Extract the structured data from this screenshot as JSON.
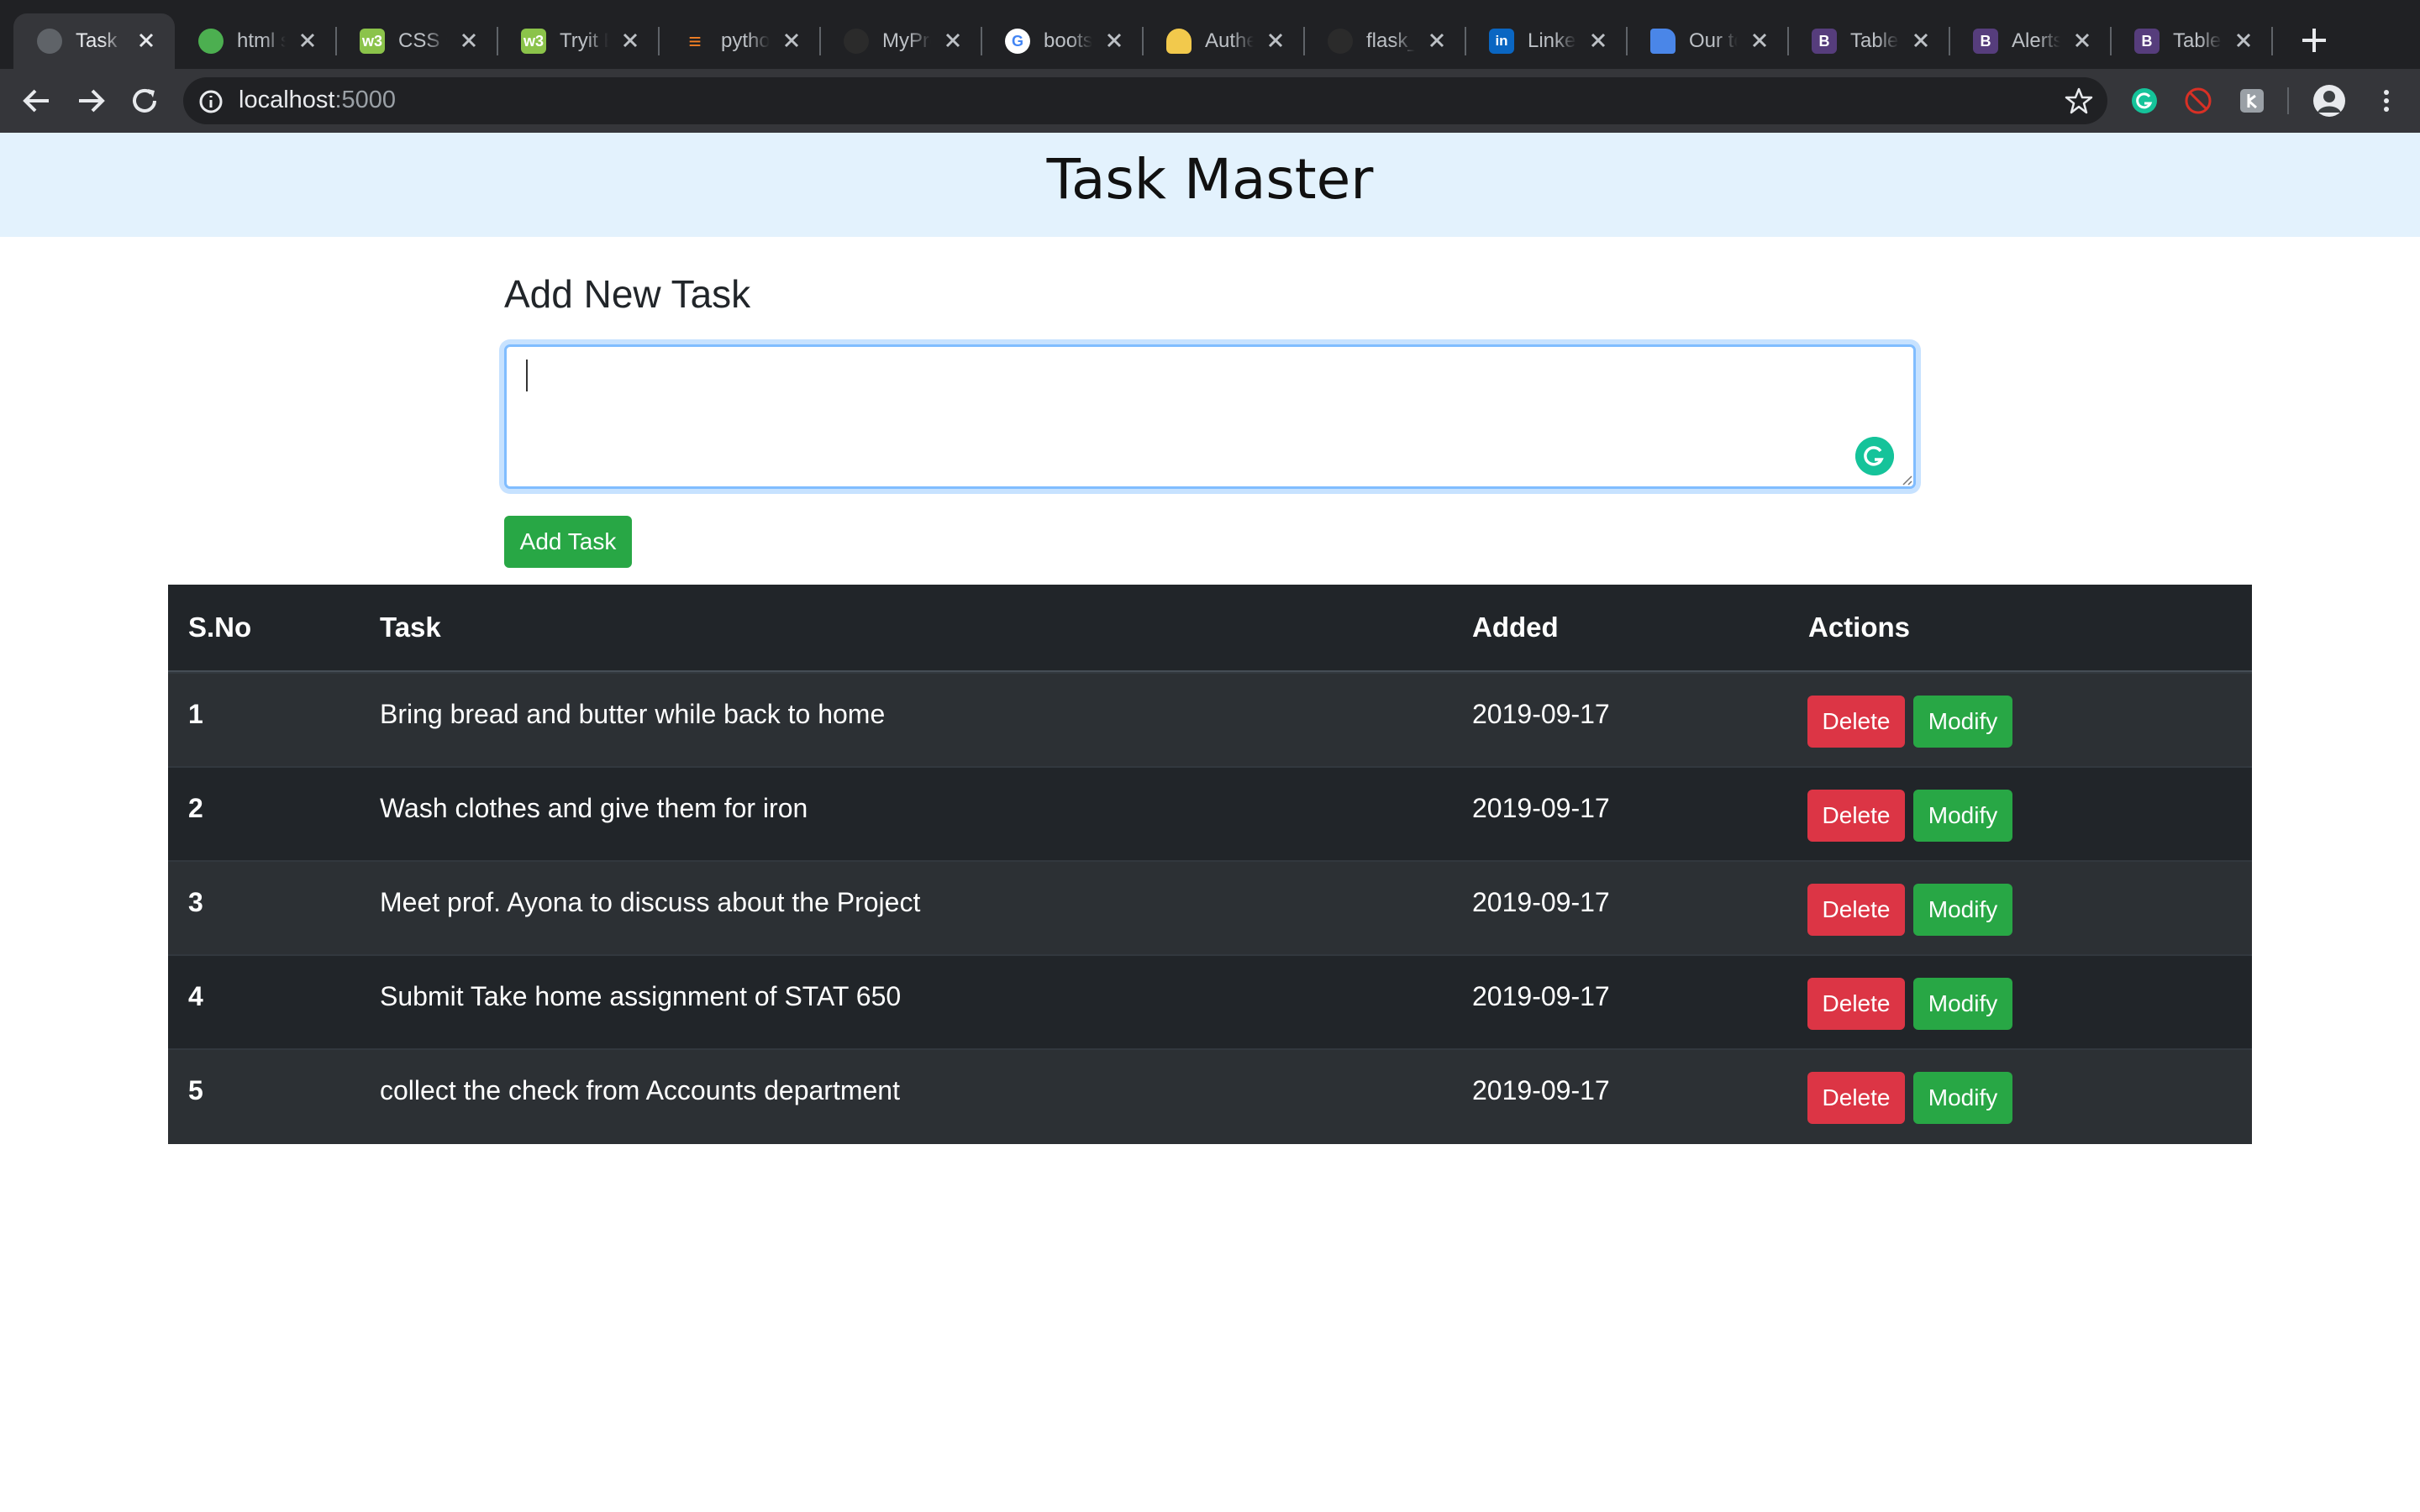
{
  "browser": {
    "tabs": [
      {
        "title": "Task Master",
        "active": true,
        "favicon": "globe-icon",
        "favicon_color": "#5f6368"
      },
      {
        "title": "html s",
        "active": false,
        "favicon": "frog-icon",
        "favicon_color": "#4caf50"
      },
      {
        "title": "CSS C",
        "active": false,
        "favicon": "w3schools-icon",
        "favicon_color": "#8bc34a"
      },
      {
        "title": "Tryit E",
        "active": false,
        "favicon": "w3schools-icon",
        "favicon_color": "#8bc34a"
      },
      {
        "title": "pytho",
        "active": false,
        "favicon": "stackoverflow-icon",
        "favicon_color": "#f48024"
      },
      {
        "title": "MyPro",
        "active": false,
        "favicon": "github-icon",
        "favicon_color": "#2b2b2b"
      },
      {
        "title": "boots",
        "active": false,
        "favicon": "google-icon",
        "favicon_color": "#ffffff"
      },
      {
        "title": "Authe",
        "active": false,
        "favicon": "person-icon",
        "favicon_color": "#f2c94c"
      },
      {
        "title": "flask_",
        "active": false,
        "favicon": "github-icon",
        "favicon_color": "#2b2b2b"
      },
      {
        "title": "Linke",
        "active": false,
        "favicon": "linkedin-icon",
        "favicon_color": "#0a66c2"
      },
      {
        "title": "Our to",
        "active": false,
        "favicon": "docs-icon",
        "favicon_color": "#4a86e8"
      },
      {
        "title": "Table",
        "active": false,
        "favicon": "bootstrap-icon",
        "favicon_color": "#563d7c"
      },
      {
        "title": "Alerts",
        "active": false,
        "favicon": "bootstrap-icon",
        "favicon_color": "#563d7c"
      },
      {
        "title": "Table",
        "active": false,
        "favicon": "bootstrap-icon",
        "favicon_color": "#563d7c"
      }
    ],
    "url_host": "localhost",
    "url_port": ":5000"
  },
  "page": {
    "title": "Task Master",
    "form": {
      "heading": "Add New Task",
      "input_value": "",
      "submit_label": "Add Task"
    },
    "table": {
      "headers": [
        "S.No",
        "Task",
        "Added",
        "Actions"
      ],
      "rows": [
        {
          "sno": "1",
          "task": "Bring bread and butter while back to home",
          "added": "2019-09-17"
        },
        {
          "sno": "2",
          "task": "Wash clothes and give them for iron",
          "added": "2019-09-17"
        },
        {
          "sno": "3",
          "task": "Meet prof. Ayona to discuss about the Project",
          "added": "2019-09-17"
        },
        {
          "sno": "4",
          "task": "Submit Take home assignment of STAT 650",
          "added": "2019-09-17"
        },
        {
          "sno": "5",
          "task": "collect the check from Accounts department",
          "added": "2019-09-17"
        }
      ],
      "delete_label": "Delete",
      "modify_label": "Modify"
    },
    "colors": {
      "header_bg": "#e3f2fd",
      "table_dark": "#212529",
      "table_striped": "#2c3034",
      "danger": "#dc3545",
      "success": "#28a745"
    }
  }
}
